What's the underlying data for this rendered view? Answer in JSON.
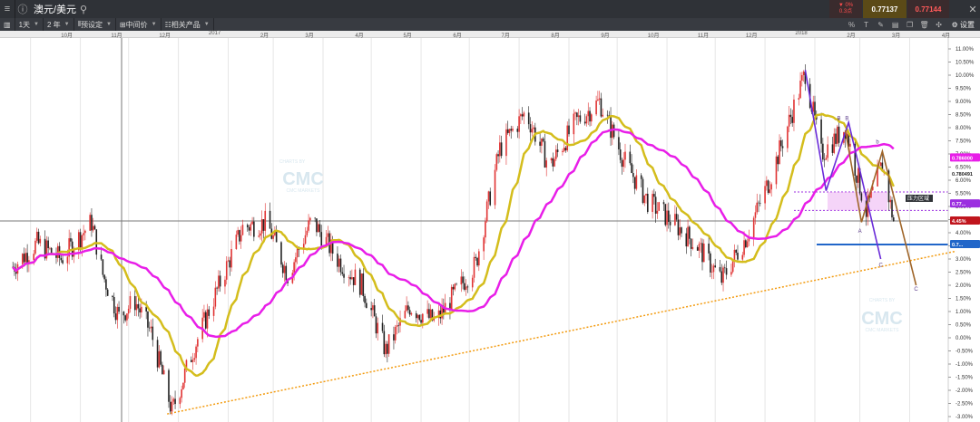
{
  "window": {
    "title": "澳元/美元",
    "change_pct": "▼ 0%",
    "change_pts": "0.3点",
    "bid": "0.77137",
    "ask": "0.77144"
  },
  "toolbar": {
    "timeframe": "1天",
    "range": "2 年",
    "preset": "预设定",
    "price_type": "中间价",
    "related": "相关产品",
    "settings": "设置"
  },
  "watermark": {
    "top": "CHARTS BY",
    "brand": "CMC",
    "bottom": "CMC MARKETS"
  },
  "chart_data": {
    "type": "candlestick",
    "symbol": "澳元/美元",
    "x_labels": [
      "10月",
      "11月",
      "12月",
      "2017",
      "2月",
      "3月",
      "4月",
      "5月",
      "6月",
      "7月",
      "8月",
      "9月",
      "10月",
      "11月",
      "12月",
      "2018",
      "2月",
      "3月",
      "4月"
    ],
    "y_ticks": [
      "11.00%",
      "10.50%",
      "10.00%",
      "9.50%",
      "9.00%",
      "8.50%",
      "8.00%",
      "7.50%",
      "7.00%",
      "6.50%",
      "6.00%",
      "5.50%",
      "5.00%",
      "4.50%",
      "4.00%",
      "3.50%",
      "3.00%",
      "2.50%",
      "2.00%",
      "1.50%",
      "1.00%",
      "0.50%",
      "0.00%",
      "-0.50%",
      "-1.00%",
      "-1.50%",
      "-2.00%",
      "-2.50%",
      "-3.00%"
    ],
    "ylim": [
      -3.0,
      11.0
    ],
    "last_change_label": "4.45%",
    "price_tags": [
      "0.786000",
      "0.780491",
      "0.77...",
      "0.7..."
    ],
    "annotations": {
      "zone_label": "压力区域",
      "points": [
        "B",
        "B",
        "A",
        "C",
        "C",
        "b"
      ]
    },
    "close_path": [
      {
        "x": "2016-09-20",
        "y": 2.7
      },
      {
        "x": "2016-10-05",
        "y": 3.6
      },
      {
        "x": "2016-10-20",
        "y": 3.0
      },
      {
        "x": "2016-11-08",
        "y": 4.4
      },
      {
        "x": "2016-11-15",
        "y": 2.4
      },
      {
        "x": "2016-11-25",
        "y": 0.8
      },
      {
        "x": "2016-12-05",
        "y": 1.4
      },
      {
        "x": "2016-12-15",
        "y": 0.2
      },
      {
        "x": "2016-12-28",
        "y": -2.8
      },
      {
        "x": "2017-01-10",
        "y": -0.5
      },
      {
        "x": "2017-01-25",
        "y": 1.8
      },
      {
        "x": "2017-02-10",
        "y": 4.2
      },
      {
        "x": "2017-02-25",
        "y": 4.4
      },
      {
        "x": "2017-03-10",
        "y": 2.4
      },
      {
        "x": "2017-03-25",
        "y": 4.5
      },
      {
        "x": "2017-04-10",
        "y": 3.0
      },
      {
        "x": "2017-04-25",
        "y": 2.0
      },
      {
        "x": "2017-05-10",
        "y": -0.5
      },
      {
        "x": "2017-05-25",
        "y": 1.2
      },
      {
        "x": "2017-06-10",
        "y": 0.6
      },
      {
        "x": "2017-06-20",
        "y": 1.5
      },
      {
        "x": "2017-07-05",
        "y": 2.8
      },
      {
        "x": "2017-07-20",
        "y": 7.2
      },
      {
        "x": "2017-08-05",
        "y": 8.6
      },
      {
        "x": "2017-08-20",
        "y": 6.5
      },
      {
        "x": "2017-09-05",
        "y": 8.2
      },
      {
        "x": "2017-09-20",
        "y": 9.0
      },
      {
        "x": "2017-10-05",
        "y": 6.8
      },
      {
        "x": "2017-10-20",
        "y": 5.2
      },
      {
        "x": "2017-11-05",
        "y": 4.4
      },
      {
        "x": "2017-11-20",
        "y": 3.5
      },
      {
        "x": "2017-12-05",
        "y": 2.2
      },
      {
        "x": "2017-12-20",
        "y": 3.8
      },
      {
        "x": "2018-01-05",
        "y": 6.2
      },
      {
        "x": "2018-01-26",
        "y": 10.1
      },
      {
        "x": "2018-02-05",
        "y": 7.0
      },
      {
        "x": "2018-02-20",
        "y": 8.0
      },
      {
        "x": "2018-03-05",
        "y": 4.8
      },
      {
        "x": "2018-03-15",
        "y": 6.6
      },
      {
        "x": "2018-03-22",
        "y": 4.45
      }
    ],
    "series": [
      {
        "name": "MA-short",
        "color": "#d4bd1c"
      },
      {
        "name": "MA-long",
        "color": "#e81ee8"
      }
    ],
    "horizontal_lines": [
      {
        "y": 4.45,
        "color": "#7a7a7a"
      },
      {
        "y": 3.55,
        "color": "#2166c9"
      },
      {
        "y": 5.55,
        "color": "#9b2ee0",
        "dotted": true
      },
      {
        "y": 4.85,
        "color": "#9b2ee0",
        "dotted": true
      }
    ],
    "trendline": {
      "from": {
        "x": "2016-12-25",
        "y": -2.9
      },
      "to": {
        "x": "2018-04-30",
        "y": 3.3
      },
      "color": "#f39c12"
    }
  }
}
